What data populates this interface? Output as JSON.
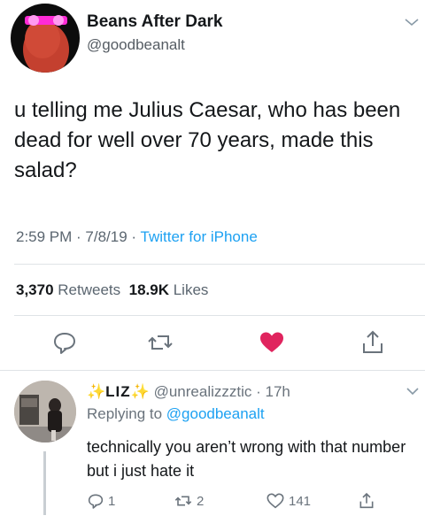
{
  "tweet": {
    "author_name": "Beans After Dark",
    "author_handle": "@goodbeanalt",
    "text": "u telling me Julius Caesar, who has been dead for well over 70 years, made this salad?",
    "time": "2:59 PM",
    "sep1": " · ",
    "date": "7/8/19",
    "sep2": " · ",
    "source": "Twitter for iPhone",
    "retweets_count": "3,370",
    "retweets_label": "Retweets",
    "likes_count": "18.9K",
    "likes_label": "Likes",
    "liked": true,
    "colors": {
      "like": "#e0245e",
      "link": "#1da1f2",
      "text": "#14171a",
      "muted": "#5b6670"
    }
  },
  "reply": {
    "sparkle_left": "✨",
    "display_name": "LIZ",
    "sparkle_right": "✨",
    "handle": "@unrealizzztic",
    "sep": " · ",
    "age": "17h",
    "replying_prefix": "Replying to ",
    "replying_to": "@goodbeanalt",
    "text": "technically you aren’t wrong with that number but i just hate it",
    "reply_count": "1",
    "retweet_count": "2",
    "like_count": "141"
  },
  "icons": {
    "avatar_glasses": "glowing-eyes-icon",
    "reply": "reply-icon",
    "retweet": "retweet-icon",
    "like": "heart-icon",
    "share": "share-icon",
    "menu": "chevron-down-icon"
  }
}
